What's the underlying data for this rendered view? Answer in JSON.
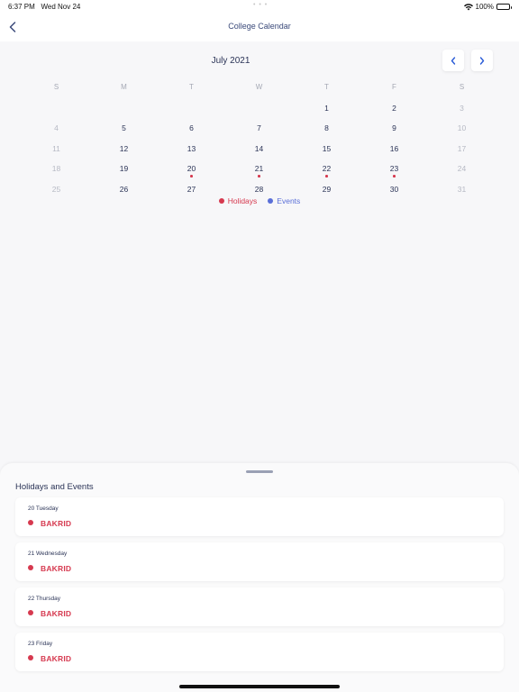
{
  "status": {
    "time": "6:37 PM",
    "date": "Wed Nov 24",
    "battery": "100%"
  },
  "nav": {
    "title": "College Calendar"
  },
  "calendar": {
    "month": "July 2021",
    "weekdays": [
      "S",
      "M",
      "T",
      "W",
      "T",
      "F",
      "S"
    ],
    "weeks": [
      [
        "",
        "",
        "",
        "",
        "1",
        "2",
        "3"
      ],
      [
        "4",
        "5",
        "6",
        "7",
        "8",
        "9",
        "10"
      ],
      [
        "11",
        "12",
        "13",
        "14",
        "15",
        "16",
        "17"
      ],
      [
        "18",
        "19",
        "20",
        "21",
        "22",
        "23",
        "24"
      ],
      [
        "25",
        "26",
        "27",
        "28",
        "29",
        "30",
        "31"
      ]
    ],
    "holiday_days": [
      "20",
      "21",
      "22",
      "23"
    ]
  },
  "legend": {
    "holidays": "Holidays",
    "events": "Events",
    "holiday_color": "#d6394f",
    "event_color": "#5a6fd8"
  },
  "sheet": {
    "title": "Holidays and Events",
    "events": [
      {
        "date": "20 Tuesday",
        "name": "BAKRID"
      },
      {
        "date": "21 Wednesday",
        "name": "BAKRID"
      },
      {
        "date": "22 Thursday",
        "name": "BAKRID"
      },
      {
        "date": "23 Friday",
        "name": "BAKRID"
      }
    ]
  }
}
